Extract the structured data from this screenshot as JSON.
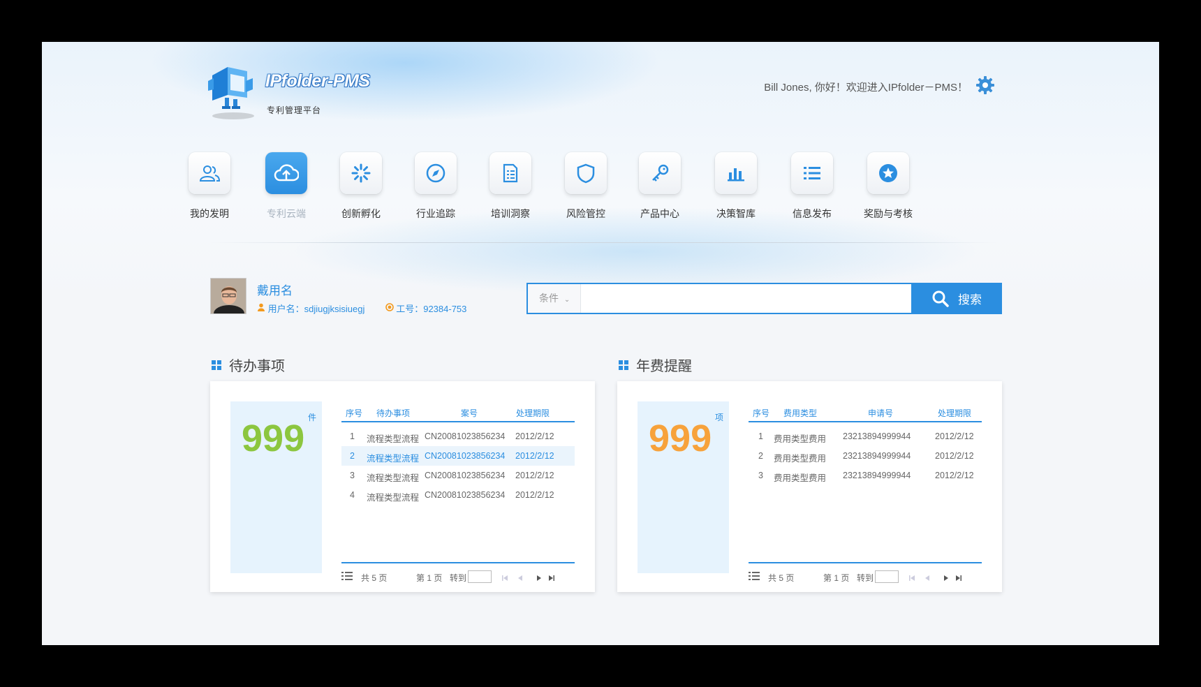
{
  "app": {
    "name": "IPfolder-PMS",
    "subtitle": "专利管理平台",
    "welcome": "Bill Jones, 你好！欢迎进入IPfolder－PMS！"
  },
  "nav": [
    {
      "label": "我的发明",
      "icon": "users-icon"
    },
    {
      "label": "专利云端",
      "icon": "cloud-upload-icon",
      "active": true
    },
    {
      "label": "创新孵化",
      "icon": "spinner-icon"
    },
    {
      "label": "行业追踪",
      "icon": "compass-icon"
    },
    {
      "label": "培训洞察",
      "icon": "document-icon"
    },
    {
      "label": "风险管控",
      "icon": "shield-icon"
    },
    {
      "label": "产品中心",
      "icon": "key-icon"
    },
    {
      "label": "决策智库",
      "icon": "bar-chart-icon"
    },
    {
      "label": "信息发布",
      "icon": "list-icon"
    },
    {
      "label": "奖励与考核",
      "icon": "star-icon"
    }
  ],
  "user": {
    "name": "戴用名",
    "username_label": "用户名：sdjiugjksisiuegj",
    "employee_label": "工号：92384-753"
  },
  "search": {
    "condition": "条件",
    "button": "搜索",
    "placeholder": ""
  },
  "todo": {
    "title": "待办事项",
    "count": "999",
    "unit": "件",
    "headers": [
      "序号",
      "待办事项",
      "案号",
      "处理期限"
    ],
    "rows": [
      [
        "1",
        "流程类型流程",
        "CN20081023856234",
        "2012/2/12"
      ],
      [
        "2",
        "流程类型流程",
        "CN20081023856234",
        "2012/2/12"
      ],
      [
        "3",
        "流程类型流程",
        "CN20081023856234",
        "2012/2/12"
      ],
      [
        "4",
        "流程类型流程",
        "CN20081023856234",
        "2012/2/12"
      ]
    ],
    "total": "共 5 页",
    "page": "第 1 页",
    "goto": "转到"
  },
  "fee": {
    "title": "年费提醒",
    "count": "999",
    "unit": "项",
    "headers": [
      "序号",
      "费用类型",
      "申请号",
      "处理期限"
    ],
    "rows": [
      [
        "1",
        "费用类型费用",
        "23213894999944",
        "2012/2/12"
      ],
      [
        "2",
        "费用类型费用",
        "23213894999944",
        "2012/2/12"
      ],
      [
        "3",
        "费用类型费用",
        "23213894999944",
        "2012/2/12"
      ]
    ],
    "total": "共 5 页",
    "page": "第 1 页",
    "goto": "转到"
  },
  "colors": {
    "accent": "#2b8ee0",
    "todo_count": "#8cc63f",
    "fee_count": "#f7a23b"
  }
}
